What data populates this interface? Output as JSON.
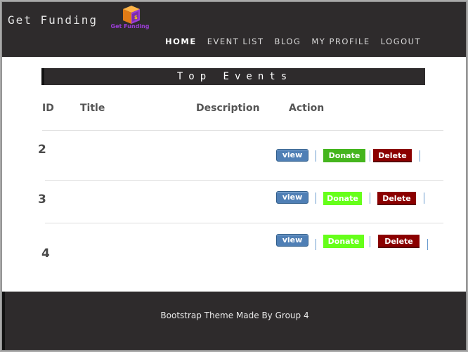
{
  "header": {
    "brand": "Get Funding",
    "logo_text": "Get Funding",
    "nav": [
      {
        "label": "HOME",
        "active": true
      },
      {
        "label": "EVENT LIST",
        "active": false
      },
      {
        "label": "BLOG",
        "active": false
      },
      {
        "label": "MY PROFILE",
        "active": false
      },
      {
        "label": "LOGOUT",
        "active": false
      }
    ]
  },
  "main": {
    "banner_title": "Top Events",
    "columns": [
      "ID",
      "Title",
      "Description",
      "Action"
    ],
    "rows": [
      {
        "id": "2",
        "title": "",
        "description": "",
        "view": "view",
        "donate": "Donate",
        "delete": "Delete"
      },
      {
        "id": "3",
        "title": "",
        "description": "",
        "view": "view",
        "donate": "Donate",
        "delete": "Delete"
      },
      {
        "id": "4",
        "title": "",
        "description": "",
        "view": "view",
        "donate": "Donate",
        "delete": "Delete"
      }
    ]
  },
  "footer": {
    "text": "Bootstrap Theme  Made By Group 4"
  },
  "colors": {
    "header_bg": "#2e2b2c",
    "view_button": "#4f7fb5",
    "donate_button_row1": "#45b51e",
    "donate_button_other": "#66ff1a",
    "delete_button": "#8b0000"
  }
}
